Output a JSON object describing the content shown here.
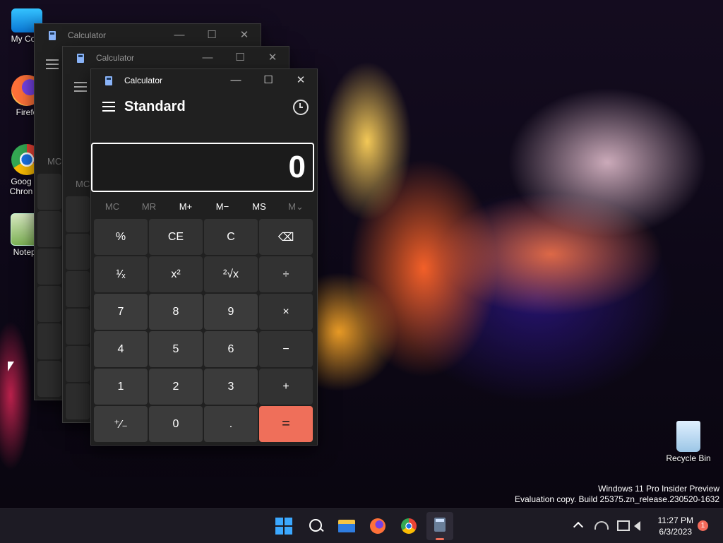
{
  "desktop": {
    "icons": [
      {
        "label": "My Com"
      },
      {
        "label": "Firefo"
      },
      {
        "label": "Goog Chron"
      },
      {
        "label": "Notepa"
      },
      {
        "label": "Recycle Bin"
      }
    ],
    "watermark": {
      "line1": "Windows 11 Pro Insider Preview",
      "line2": "Evaluation copy. Build 25375.zn_release.230520-1632"
    }
  },
  "windows_behind": [
    {
      "title": "Calculator",
      "mem_label": "MC"
    },
    {
      "title": "Calculator",
      "mem_label": "MC"
    }
  ],
  "calculator": {
    "title": "Calculator",
    "mode": "Standard",
    "display": "0",
    "controls": {
      "minimize": "—",
      "maximize": "☐",
      "close": "✕"
    },
    "memory": [
      "MC",
      "MR",
      "M+",
      "M−",
      "MS",
      "M⌄"
    ],
    "keys": [
      "%",
      "CE",
      "C",
      "⌫",
      "¹⁄ₓ",
      "x²",
      "²√x",
      "÷",
      "7",
      "8",
      "9",
      "×",
      "4",
      "5",
      "6",
      "−",
      "1",
      "2",
      "3",
      "+",
      "⁺⁄₋",
      "0",
      ".",
      "="
    ]
  },
  "taskbar": {
    "time": "11:27 PM",
    "date": "6/3/2023",
    "notification_count": "1",
    "icons": [
      "windows-start-icon",
      "search-icon",
      "file-explorer-icon",
      "firefox-icon",
      "chrome-icon",
      "calculator-icon"
    ],
    "tray": [
      "chevron-up-icon",
      "network-off-icon",
      "display-icon",
      "volume-icon"
    ]
  }
}
